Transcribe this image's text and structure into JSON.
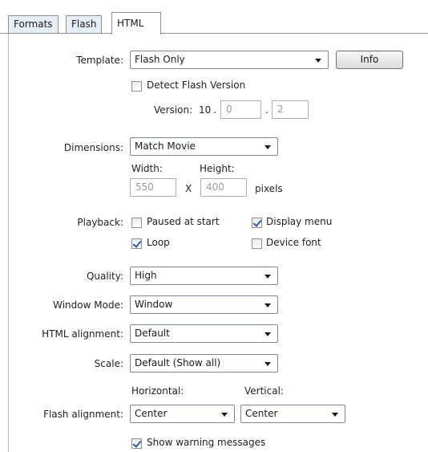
{
  "tabs": [
    {
      "label": "Formats",
      "active": false
    },
    {
      "label": "Flash",
      "active": false
    },
    {
      "label": "HTML",
      "active": true
    }
  ],
  "template": {
    "label": "Template:",
    "value": "Flash Only",
    "info_button": "Info"
  },
  "detect_flash": {
    "label": "Detect Flash Version",
    "checked": false
  },
  "version": {
    "label": "Version:",
    "major": "10",
    "sep1": ".",
    "minor": "0",
    "sep2": ".",
    "revision": "2"
  },
  "dimensions": {
    "label": "Dimensions:",
    "value": "Match Movie",
    "width_label": "Width:",
    "height_label": "Height:",
    "width": "550",
    "times": "X",
    "height": "400",
    "units": "pixels"
  },
  "playback": {
    "label": "Playback:",
    "paused_at_start": {
      "label": "Paused at start",
      "checked": false
    },
    "display_menu": {
      "label": "Display menu",
      "checked": true
    },
    "loop": {
      "label": "Loop",
      "checked": true
    },
    "device_font": {
      "label": "Device font",
      "checked": false
    }
  },
  "quality": {
    "label": "Quality:",
    "value": "High"
  },
  "window_mode": {
    "label": "Window Mode:",
    "value": "Window"
  },
  "html_alignment": {
    "label": "HTML alignment:",
    "value": "Default"
  },
  "scale": {
    "label": "Scale:",
    "value": "Default (Show all)"
  },
  "flash_alignment": {
    "label": "Flash alignment:",
    "horizontal_label": "Horizontal:",
    "horizontal": "Center",
    "vertical_label": "Vertical:",
    "vertical": "Center"
  },
  "show_warnings": {
    "label": "Show warning messages",
    "checked": true
  },
  "colors": {
    "tab_inactive": "#e6eef8",
    "border": "#8e8f8f",
    "check": "#2a58ad"
  }
}
